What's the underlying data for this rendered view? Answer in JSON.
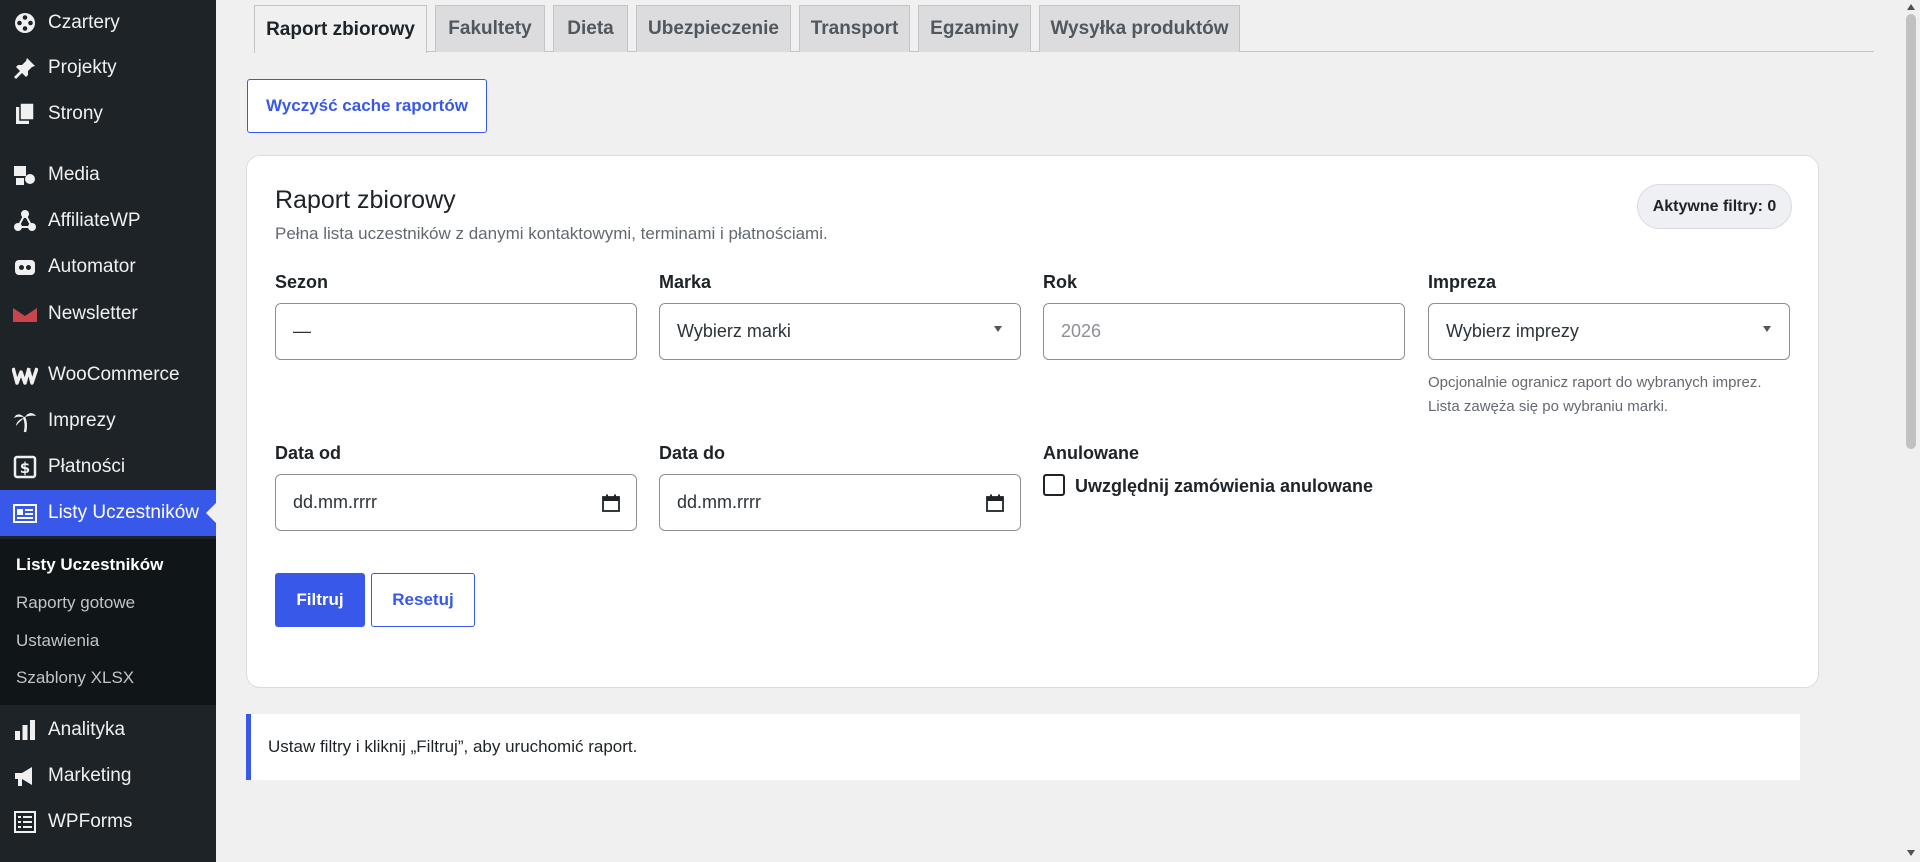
{
  "sidebar": {
    "items": [
      {
        "label": "Czartery",
        "icon": "film-reel-icon"
      },
      {
        "label": "Projekty",
        "icon": "pushpin-icon"
      },
      {
        "label": "Strony",
        "icon": "pages-icon"
      },
      {
        "label": "Media",
        "icon": "media-icon"
      },
      {
        "label": "AffiliateWP",
        "icon": "affiliate-icon"
      },
      {
        "label": "Automator",
        "icon": "robot-icon"
      },
      {
        "label": "Newsletter",
        "icon": "envelope-icon"
      },
      {
        "label": "WooCommerce",
        "icon": "woo-icon"
      },
      {
        "label": "Imprezy",
        "icon": "palm-tree-icon"
      },
      {
        "label": "Płatności",
        "icon": "dollar-icon"
      },
      {
        "label": "Listy Uczestników",
        "icon": "id-card-icon"
      },
      {
        "label": "Analityka",
        "icon": "bar-chart-icon"
      },
      {
        "label": "Marketing",
        "icon": "megaphone-icon"
      },
      {
        "label": "WPForms",
        "icon": "form-icon"
      }
    ],
    "submenu": [
      "Listy Uczestników",
      "Raporty gotowe",
      "Ustawienia",
      "Szablony XLSX"
    ]
  },
  "tabs": [
    "Raport zbiorowy",
    "Fakultety",
    "Dieta",
    "Ubezpieczenie",
    "Transport",
    "Egzaminy",
    "Wysyłka produktów"
  ],
  "clear_cache_label": "Wyczyść cache raportów",
  "card": {
    "title": "Raport zbiorowy",
    "description": "Pełna lista uczestników z danymi kontaktowymi, terminami i płatnościami.",
    "active_filters": "Aktywne filtry: 0"
  },
  "form": {
    "season": {
      "label": "Sezon",
      "value": "—"
    },
    "brand": {
      "label": "Marka",
      "value": "Wybierz marki"
    },
    "year": {
      "label": "Rok",
      "placeholder": "2026"
    },
    "event": {
      "label": "Impreza",
      "value": "Wybierz imprezy",
      "help_line1": "Opcjonalnie ogranicz raport do wybranych imprez.",
      "help_line2": "Lista zawęża się po wybraniu marki."
    },
    "date_from": {
      "label": "Data od",
      "value": "dd.mm.rrrr"
    },
    "date_to": {
      "label": "Data do",
      "value": "dd.mm.rrrr"
    },
    "cancelled": {
      "label": "Anulowane",
      "checkbox_label": "Uwzględnij zamówienia anulowane"
    },
    "filter_label": "Filtruj",
    "reset_label": "Resetuj"
  },
  "notice": "Ustaw filtry i kliknij „Filtruj”, aby uruchomić raport.",
  "colors": {
    "accent": "#3858e9",
    "sidebar_bg": "#1d2327",
    "page_bg": "#f0f0f1"
  }
}
